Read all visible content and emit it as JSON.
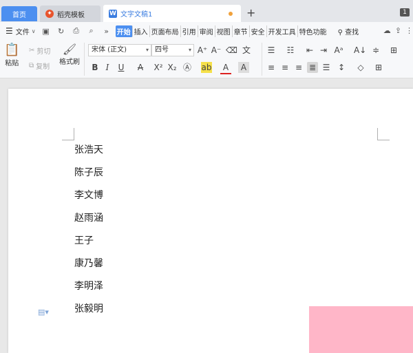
{
  "tabs": {
    "home": "首页",
    "template": "稻壳模板",
    "doc": "文字文稿1",
    "add": "+",
    "badge": "1"
  },
  "menubar": {
    "file": "文件",
    "ribbon_tabs": [
      "开始",
      "插入",
      "页面布局",
      "引用",
      "审阅",
      "视图",
      "章节",
      "安全",
      "开发工具",
      "特色功能"
    ],
    "search": "查找"
  },
  "toolbar": {
    "paste": "粘贴",
    "cut": "剪切",
    "copy": "复制",
    "format_painter": "格式刷",
    "font_name": "宋体 (正文)",
    "font_size": "四号"
  },
  "document": {
    "names": [
      "张浩天",
      "陈子辰",
      "李文博",
      "赵雨涵",
      "王子",
      "康乃馨",
      "李明泽",
      "张毅明"
    ]
  },
  "colors": {
    "accent": "#4c8ff0",
    "pink_overlay": "#ffb6c8"
  }
}
